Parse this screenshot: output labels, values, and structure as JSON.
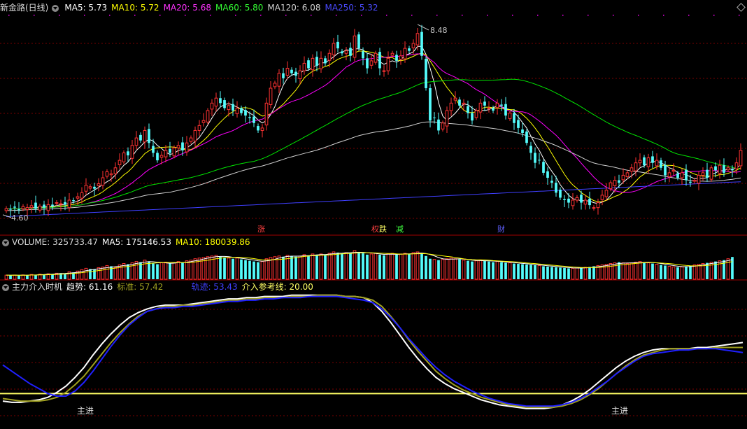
{
  "colors": {
    "up": "#ff3232",
    "down": "#54fcfc",
    "ma5": "#ffffff",
    "ma10": "#ffff00",
    "ma20": "#ff00ff",
    "ma60": "#00e600",
    "ma120": "#d0d0d0",
    "ma250": "#3f3fff",
    "grid": "#7a0000",
    "trend": "#ffffff",
    "std": "#a0a020",
    "track": "#2020ff",
    "ref": "#ffff66"
  },
  "price_header": {
    "title": "新金路(日线)",
    "ma5": "MA5: 5.73",
    "ma10": "MA10: 5.72",
    "ma20": "MA20: 5.68",
    "ma60": "MA60: 5.80",
    "ma120": "MA120: 6.08",
    "ma250": "MA250: 5.32"
  },
  "vol_header": {
    "title": "VOLUME: 325733.47",
    "ma5": "MA5: 175146.53",
    "ma10": "MA10: 180039.86"
  },
  "ind_header": {
    "title": "主力介入时机",
    "trend": "趋势: 61.16",
    "std": "标准: 57.42",
    "track": "轨迹: 53.43",
    "ref": "介入参考线: 20.00"
  },
  "tags": {
    "t1": "涨",
    "t2a": "权",
    "t2b": "跌",
    "t3": "减",
    "t4": "财"
  },
  "signals": {
    "s1": "主进",
    "s2": "主进"
  },
  "chart_data": [
    {
      "type": "candlestick",
      "name": "price",
      "high_label": "8.48",
      "low_label": "4.60",
      "ylim": [
        4.5,
        8.55
      ],
      "ma_values": {
        "MA5": 5.73,
        "MA10": 5.72,
        "MA20": 5.68,
        "MA60": 5.8,
        "MA120": 6.08,
        "MA250": 5.32
      },
      "close": [
        4.78,
        4.76,
        4.8,
        4.75,
        4.82,
        4.8,
        4.84,
        4.78,
        4.83,
        4.8,
        4.86,
        4.83,
        4.9,
        4.88,
        4.86,
        4.95,
        4.93,
        5.02,
        5.1,
        5.25,
        5.22,
        5.18,
        5.28,
        5.4,
        5.52,
        5.48,
        5.6,
        5.75,
        5.9,
        5.85,
        6.05,
        6.2,
        6.15,
        6.35,
        6.1,
        5.9,
        5.75,
        5.85,
        5.95,
        5.9,
        6.0,
        6.05,
        5.95,
        6.1,
        6.2,
        6.35,
        6.45,
        6.55,
        6.75,
        6.9,
        7.0,
        6.9,
        6.8,
        6.85,
        6.75,
        6.8,
        6.7,
        6.65,
        6.6,
        6.5,
        6.35,
        6.4,
        6.9,
        7.2,
        7.3,
        7.5,
        7.4,
        7.6,
        7.5,
        7.45,
        7.55,
        7.7,
        7.6,
        7.8,
        7.65,
        7.8,
        7.7,
        7.9,
        8.1,
        8.0,
        7.9,
        7.95,
        7.85,
        8.25,
        8.0,
        7.8,
        7.6,
        7.75,
        7.9,
        7.6,
        7.55,
        7.8,
        7.9,
        7.75,
        7.85,
        8.0,
        7.95,
        8.1,
        8.3,
        7.85,
        7.2,
        6.55,
        6.6,
        6.35,
        6.5,
        6.75,
        6.9,
        7.0,
        6.85,
        6.9,
        6.7,
        6.55,
        6.75,
        6.9,
        6.85,
        6.8,
        6.75,
        6.9,
        6.85,
        6.65,
        6.7,
        6.5,
        6.4,
        6.3,
        6.1,
        5.9,
        5.7,
        5.75,
        5.5,
        5.4,
        5.3,
        5.1,
        5.0,
        4.95,
        4.9,
        4.95,
        5.0,
        4.9,
        4.95,
        4.85,
        4.8,
        4.9,
        5.05,
        5.15,
        5.3,
        5.35,
        5.3,
        5.45,
        5.5,
        5.6,
        5.7,
        5.75,
        5.65,
        5.8,
        5.7,
        5.75,
        5.6,
        5.45,
        5.5,
        5.55,
        5.4,
        5.5,
        5.35,
        5.3,
        5.35,
        5.45,
        5.5,
        5.4,
        5.6,
        5.55,
        5.65,
        5.5,
        5.6,
        5.55,
        5.7,
        5.95
      ]
    },
    {
      "type": "bar",
      "name": "volume",
      "ma5": 175146.53,
      "ma10": 180039.86,
      "last": 325733.47,
      "values": [
        60,
        58,
        62,
        55,
        64,
        60,
        70,
        66,
        75,
        72,
        80,
        78,
        88,
        90,
        85,
        110,
        100,
        120,
        140,
        160,
        150,
        145,
        170,
        180,
        200,
        190,
        175,
        210,
        230,
        220,
        240,
        260,
        250,
        280,
        260,
        230,
        220,
        240,
        250,
        230,
        240,
        260,
        240,
        270,
        280,
        300,
        310,
        320,
        330,
        340,
        350,
        330,
        320,
        310,
        300,
        310,
        290,
        280,
        270,
        260,
        250,
        260,
        300,
        320,
        330,
        340,
        330,
        350,
        340,
        330,
        340,
        360,
        350,
        370,
        360,
        370,
        360,
        380,
        400,
        390,
        380,
        390,
        380,
        420,
        400,
        380,
        360,
        370,
        380,
        360,
        350,
        370,
        380,
        360,
        370,
        380,
        370,
        390,
        400,
        380,
        340,
        300,
        290,
        280,
        290,
        300,
        310,
        300,
        290,
        280,
        270,
        260,
        270,
        280,
        270,
        260,
        250,
        260,
        250,
        240,
        240,
        230,
        225,
        220,
        215,
        210,
        205,
        200,
        190,
        185,
        180,
        175,
        170,
        165,
        160,
        160,
        165,
        170,
        175,
        180,
        190,
        200,
        210,
        220,
        230,
        240,
        250,
        240,
        230,
        240,
        250,
        260,
        250,
        240,
        230,
        220,
        210,
        200,
        190,
        180,
        175,
        180,
        190,
        200,
        210,
        220,
        230,
        240,
        250,
        260,
        270,
        280,
        300,
        326
      ]
    },
    {
      "type": "line",
      "name": "indicator",
      "ylim": [
        0,
        100
      ],
      "ref_value": 20.0,
      "series": [
        {
          "name": "趋势",
          "last": 61.16,
          "values": [
            14,
            13,
            13,
            14,
            15,
            17,
            21,
            26,
            33,
            41,
            51,
            60,
            68,
            75,
            81,
            85,
            88,
            90,
            91,
            91,
            91,
            92,
            93,
            94,
            95,
            96,
            96,
            97,
            97,
            98,
            98,
            98,
            99,
            99,
            99,
            99,
            99,
            99,
            98,
            98,
            97,
            93,
            86,
            77,
            67,
            57,
            48,
            40,
            33,
            28,
            24,
            21,
            18,
            15,
            13,
            11,
            10,
            9,
            8,
            8,
            8,
            9,
            11,
            14,
            18,
            23,
            29,
            35,
            41,
            46,
            50,
            53,
            55,
            56,
            56,
            56,
            56,
            57,
            57,
            58,
            59,
            60,
            61
          ]
        },
        {
          "name": "标准",
          "last": 57.42,
          "values": [
            16,
            15,
            14,
            14,
            14,
            15,
            17,
            21,
            27,
            34,
            43,
            52,
            61,
            69,
            76,
            82,
            86,
            88,
            90,
            90,
            91,
            91,
            92,
            93,
            94,
            95,
            95,
            96,
            96,
            97,
            97,
            97,
            98,
            98,
            98,
            99,
            99,
            99,
            98,
            98,
            97,
            95,
            90,
            82,
            73,
            63,
            54,
            46,
            38,
            32,
            27,
            23,
            20,
            17,
            15,
            13,
            11,
            10,
            9,
            9,
            9,
            9,
            10,
            12,
            15,
            19,
            24,
            30,
            36,
            42,
            47,
            51,
            53,
            55,
            56,
            56,
            56,
            56,
            56,
            57,
            57,
            57,
            57
          ]
        },
        {
          "name": "轨迹",
          "last": 53.43,
          "values": [
            43,
            38,
            33,
            28,
            24,
            20,
            18,
            18,
            22,
            29,
            38,
            48,
            58,
            67,
            75,
            81,
            86,
            88,
            89,
            89,
            90,
            90,
            91,
            92,
            93,
            94,
            94,
            95,
            95,
            96,
            96,
            97,
            97,
            97,
            98,
            98,
            98,
            98,
            97,
            96,
            95,
            93,
            88,
            81,
            73,
            64,
            56,
            48,
            41,
            35,
            30,
            26,
            22,
            19,
            16,
            14,
            12,
            11,
            10,
            10,
            10,
            10,
            11,
            13,
            16,
            20,
            25,
            30,
            36,
            41,
            46,
            50,
            52,
            53,
            54,
            55,
            55,
            56,
            56,
            56,
            55,
            54,
            53
          ]
        }
      ]
    }
  ]
}
